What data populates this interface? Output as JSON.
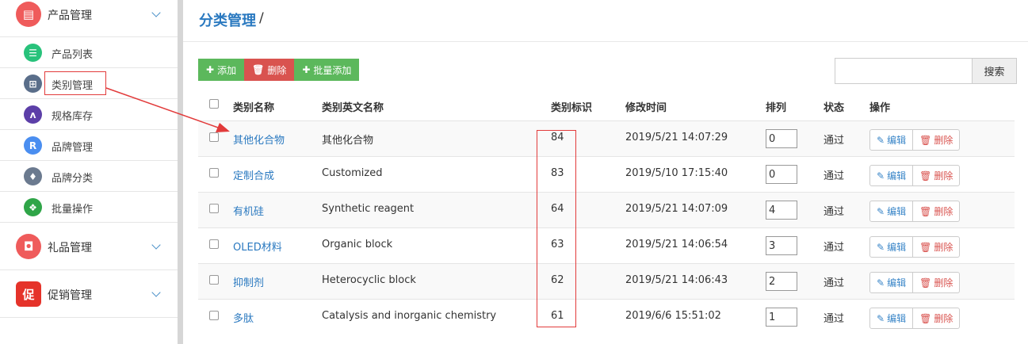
{
  "sidebar": {
    "groups": [
      {
        "label": "产品管理",
        "icon": "product-icon",
        "color": "#ef5b5b",
        "glyph": "▤"
      },
      {
        "label": "礼品管理",
        "icon": "gift-bag-icon",
        "color": "#ef5b5b",
        "glyph": "🛍"
      },
      {
        "label": "促销管理",
        "icon": "promo-icon",
        "color": "#e5332a",
        "glyph": "促"
      }
    ],
    "items": [
      {
        "label": "产品列表",
        "icon": "list-icon",
        "color": "#28c27b",
        "glyph": "☰"
      },
      {
        "label": "类别管理",
        "icon": "grid-icon",
        "color": "#5a6e8a",
        "glyph": "⊞"
      },
      {
        "label": "规格库存",
        "icon": "hierarchy-icon",
        "color": "#5c3fa8",
        "glyph": "ʌ"
      },
      {
        "label": "品牌管理",
        "icon": "brand-r-icon",
        "color": "#4a8ef0",
        "glyph": "R"
      },
      {
        "label": "品牌分类",
        "icon": "badge-icon",
        "color": "#6b7a8f",
        "glyph": "♦"
      },
      {
        "label": "批量操作",
        "icon": "batch-icon",
        "color": "#2fa548",
        "glyph": "❖"
      }
    ]
  },
  "header": {
    "title": "分类管理",
    "separator": "/"
  },
  "toolbar": {
    "add_label": "添加",
    "delete_label": "删除",
    "batch_add_label": "批量添加",
    "search_label": "搜索",
    "search_value": ""
  },
  "table": {
    "columns": [
      "类别名称",
      "类别英文名称",
      "类别标识",
      "修改时间",
      "排列",
      "状态",
      "操作"
    ],
    "edit_label": "编辑",
    "delete_label": "删除",
    "rows": [
      {
        "name": "其他化合物",
        "en": "其他化合物",
        "id": "84",
        "time": "2019/5/21 14:07:29",
        "order": "0",
        "status": "通过"
      },
      {
        "name": "定制合成",
        "en": "Customized",
        "id": "83",
        "time": "2019/5/10 17:15:40",
        "order": "0",
        "status": "通过"
      },
      {
        "name": "有机硅",
        "en": "Synthetic reagent",
        "id": "64",
        "time": "2019/5/21 14:07:09",
        "order": "4",
        "status": "通过"
      },
      {
        "name": "OLED材料",
        "en": "Organic block",
        "id": "63",
        "time": "2019/5/21 14:06:54",
        "order": "3",
        "status": "通过"
      },
      {
        "name": "抑制剂",
        "en": "Heterocyclic block",
        "id": "62",
        "time": "2019/5/21 14:06:43",
        "order": "2",
        "status": "通过"
      },
      {
        "name": "多肽",
        "en": "Catalysis and inorganic chemistry",
        "id": "61",
        "time": "2019/6/6 15:51:02",
        "order": "1",
        "status": "通过"
      }
    ]
  },
  "colors": {
    "accent": "#2a79c0",
    "annotation": "#e23b3b",
    "green": "#5cb85c",
    "red": "#d9534f"
  }
}
